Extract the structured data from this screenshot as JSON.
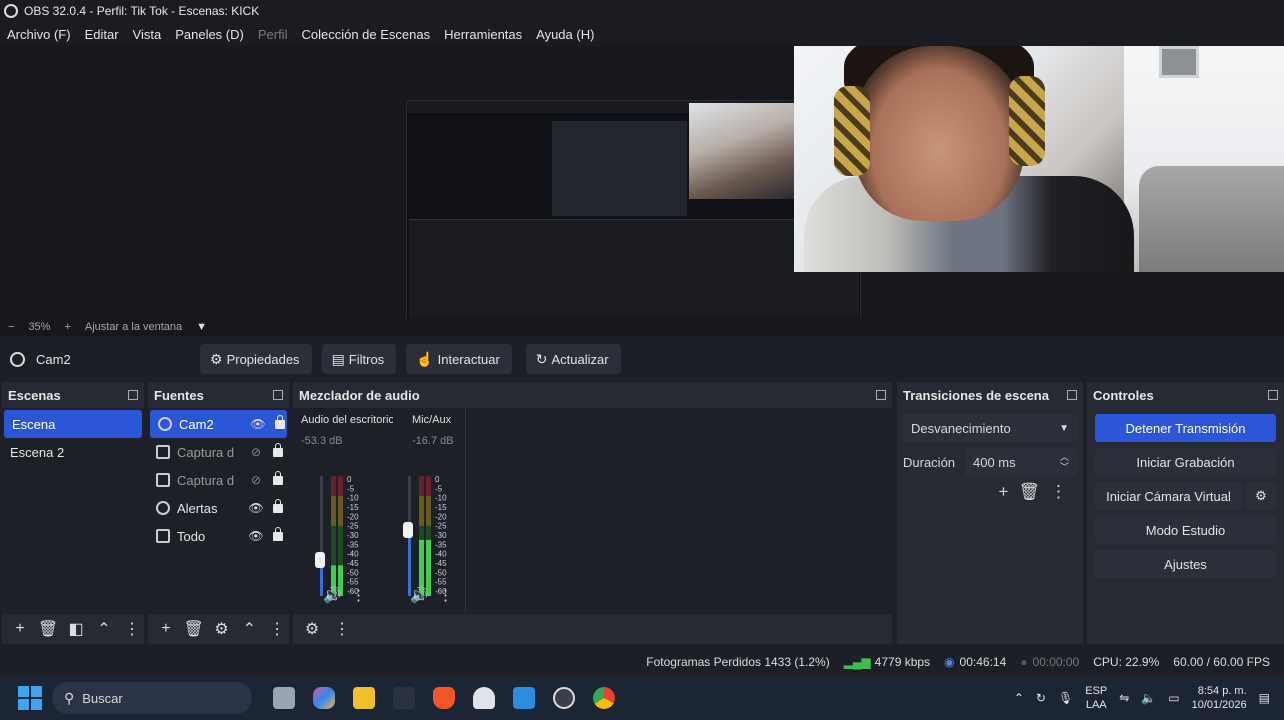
{
  "window": {
    "title": "OBS 32.0.4 - Perfil: Tik Tok - Escenas: KICK"
  },
  "menu": [
    "Archivo (F)",
    "Editar",
    "Vista",
    "Paneles (D)",
    "Perfil",
    "Colección de Escenas",
    "Herramientas",
    "Ayuda (H)"
  ],
  "zoom": {
    "minus": "−",
    "value": "35%",
    "plus": "+",
    "fit": "Ajustar a la ventana",
    "dropdown": "▼"
  },
  "source_toolbar": {
    "selected_source": "Cam2",
    "properties": "Propiedades",
    "filters": "Filtros",
    "interact": "Interactuar",
    "refresh": "Actualizar"
  },
  "scenes": {
    "title": "Escenas",
    "items": [
      "Escena",
      "Escena 2"
    ]
  },
  "sources": {
    "title": "Fuentes",
    "items": [
      {
        "name": "Cam2",
        "icon": "webcam-icon",
        "visible": true
      },
      {
        "name": "Captura d",
        "icon": "display-capture-icon",
        "visible": false
      },
      {
        "name": "Captura d",
        "icon": "display-capture-icon",
        "visible": false
      },
      {
        "name": "Alertas",
        "icon": "browser-icon",
        "visible": true
      },
      {
        "name": "Todo",
        "icon": "display-capture-icon",
        "visible": true
      }
    ]
  },
  "mixer": {
    "title": "Mezclador de audio",
    "channels": [
      {
        "name": "Audio del escritorio",
        "db": "-53.3 dB",
        "level": 0.3
      },
      {
        "name": "Mic/Aux",
        "db": "-16.7 dB",
        "level": 0.55
      }
    ],
    "scale": [
      "0",
      "-5",
      "-10",
      "-15",
      "-20",
      "-25",
      "-30",
      "-35",
      "-40",
      "-45",
      "-50",
      "-55",
      "-60"
    ]
  },
  "transitions": {
    "title": "Transiciones de escena",
    "selected": "Desvanecimiento",
    "duration_label": "Duración",
    "duration_value": "400 ms"
  },
  "controls": {
    "title": "Controles",
    "stop_stream": "Detener Transmisión",
    "start_recording": "Iniciar Grabación",
    "start_virtual_cam": "Iniciar Cámara Virtual",
    "studio_mode": "Modo Estudio",
    "settings": "Ajustes"
  },
  "status": {
    "dropped_frames": "Fotogramas Perdidos 1433 (1.2%)",
    "bitrate": "4779 kbps",
    "stream_time": "00:46:14",
    "rec_time": "00:00:00",
    "cpu": "CPU: 22.9%",
    "fps": "60.00 / 60.00 FPS"
  },
  "taskbar": {
    "search_placeholder": "Buscar",
    "lang1": "ESP",
    "lang2": "LAA",
    "time": "8:54 p. m.",
    "date": "10/01/2026"
  },
  "colors": {
    "accent": "#2c56d8",
    "bg": "#1d1f26",
    "panel": "#272a33"
  }
}
